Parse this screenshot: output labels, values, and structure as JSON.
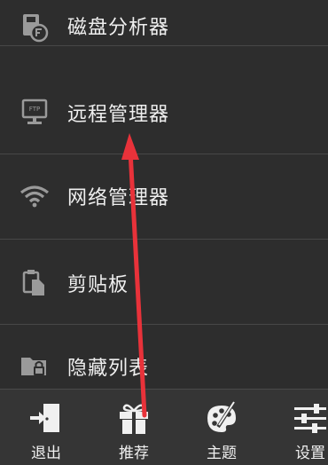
{
  "menu": {
    "items": [
      {
        "label": "磁盘分析器",
        "icon": "disk-analyzer-icon"
      },
      {
        "label": "远程管理器",
        "icon": "ftp-monitor-icon"
      },
      {
        "label": "网络管理器",
        "icon": "wifi-icon"
      },
      {
        "label": "剪贴板",
        "icon": "clipboard-icon"
      },
      {
        "label": "隐藏列表",
        "icon": "hidden-folder-icon"
      }
    ]
  },
  "bottom_bar": {
    "tabs": [
      {
        "label": "退出",
        "icon": "exit-door-icon"
      },
      {
        "label": "推荐",
        "icon": "gift-icon"
      },
      {
        "label": "主题",
        "icon": "palette-icon"
      },
      {
        "label": "设置",
        "icon": "settings-sliders-icon"
      }
    ]
  },
  "annotation": {
    "arrow_color": "#e8323a"
  },
  "colors": {
    "background": "#2d2d2d",
    "text": "#efefef",
    "divider": "#474747",
    "icon": "#9a9a9a"
  }
}
